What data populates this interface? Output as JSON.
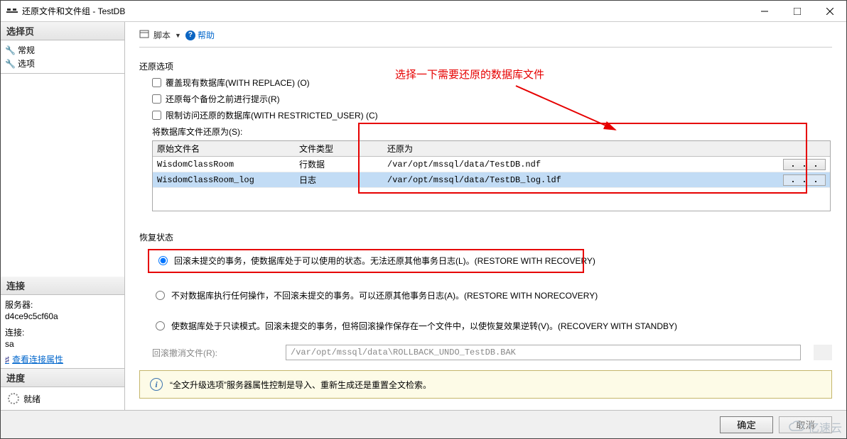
{
  "window": {
    "title": "还原文件和文件组 - TestDB"
  },
  "sidebar": {
    "select_page": {
      "header": "选择页",
      "general": "常规",
      "options": "选项"
    },
    "connection": {
      "header": "连接",
      "server_label": "服务器:",
      "server_value": "d4ce9c5cf60a",
      "conn_label": "连接:",
      "conn_value": "sa",
      "view_props": "查看连接属性"
    },
    "progress": {
      "header": "进度",
      "status": "就绪"
    }
  },
  "toolbar": {
    "script": "脚本",
    "help": "帮助"
  },
  "restore_options": {
    "title": "还原选项",
    "overwrite": "覆盖现有数据库(WITH REPLACE)  (O)",
    "prompt": "还原每个备份之前进行提示(R)",
    "restrict": "限制访问还原的数据库(WITH RESTRICTED_USER)  (C)",
    "restore_as_label": "将数据库文件还原为(S):",
    "columns": {
      "orig": "原始文件名",
      "type": "文件类型",
      "restore": "还原为"
    },
    "rows": [
      {
        "orig": "WisdomClassRoom",
        "type": "行数据",
        "restore": "/var/opt/mssql/data/TestDB.ndf"
      },
      {
        "orig": "WisdomClassRoom_log",
        "type": "日志",
        "restore": "/var/opt/mssql/data/TestDB_log.ldf"
      }
    ]
  },
  "annotation_text": "选择一下需要还原的数据库文件",
  "recovery": {
    "title": "恢复状态",
    "opt1": "回滚未提交的事务，使数据库处于可以使用的状态。无法还原其他事务日志(L)。(RESTORE WITH RECOVERY)",
    "opt2": "不对数据库执行任何操作，不回滚未提交的事务。可以还原其他事务日志(A)。(RESTORE WITH NORECOVERY)",
    "opt3": "使数据库处于只读模式。回滚未提交的事务，但将回滚操作保存在一个文件中，以使恢复效果逆转(V)。(RECOVERY WITH STANDBY)",
    "rollback_label": "回滚撤消文件(R):",
    "rollback_value": "/var/opt/mssql/data\\ROLLBACK_UNDO_TestDB.BAK"
  },
  "infobar": "“全文升级选项”服务器属性控制是导入、重新生成还是重置全文检索。",
  "buttons": {
    "ok": "确定",
    "cancel": "取消"
  },
  "watermark": "亿速云"
}
